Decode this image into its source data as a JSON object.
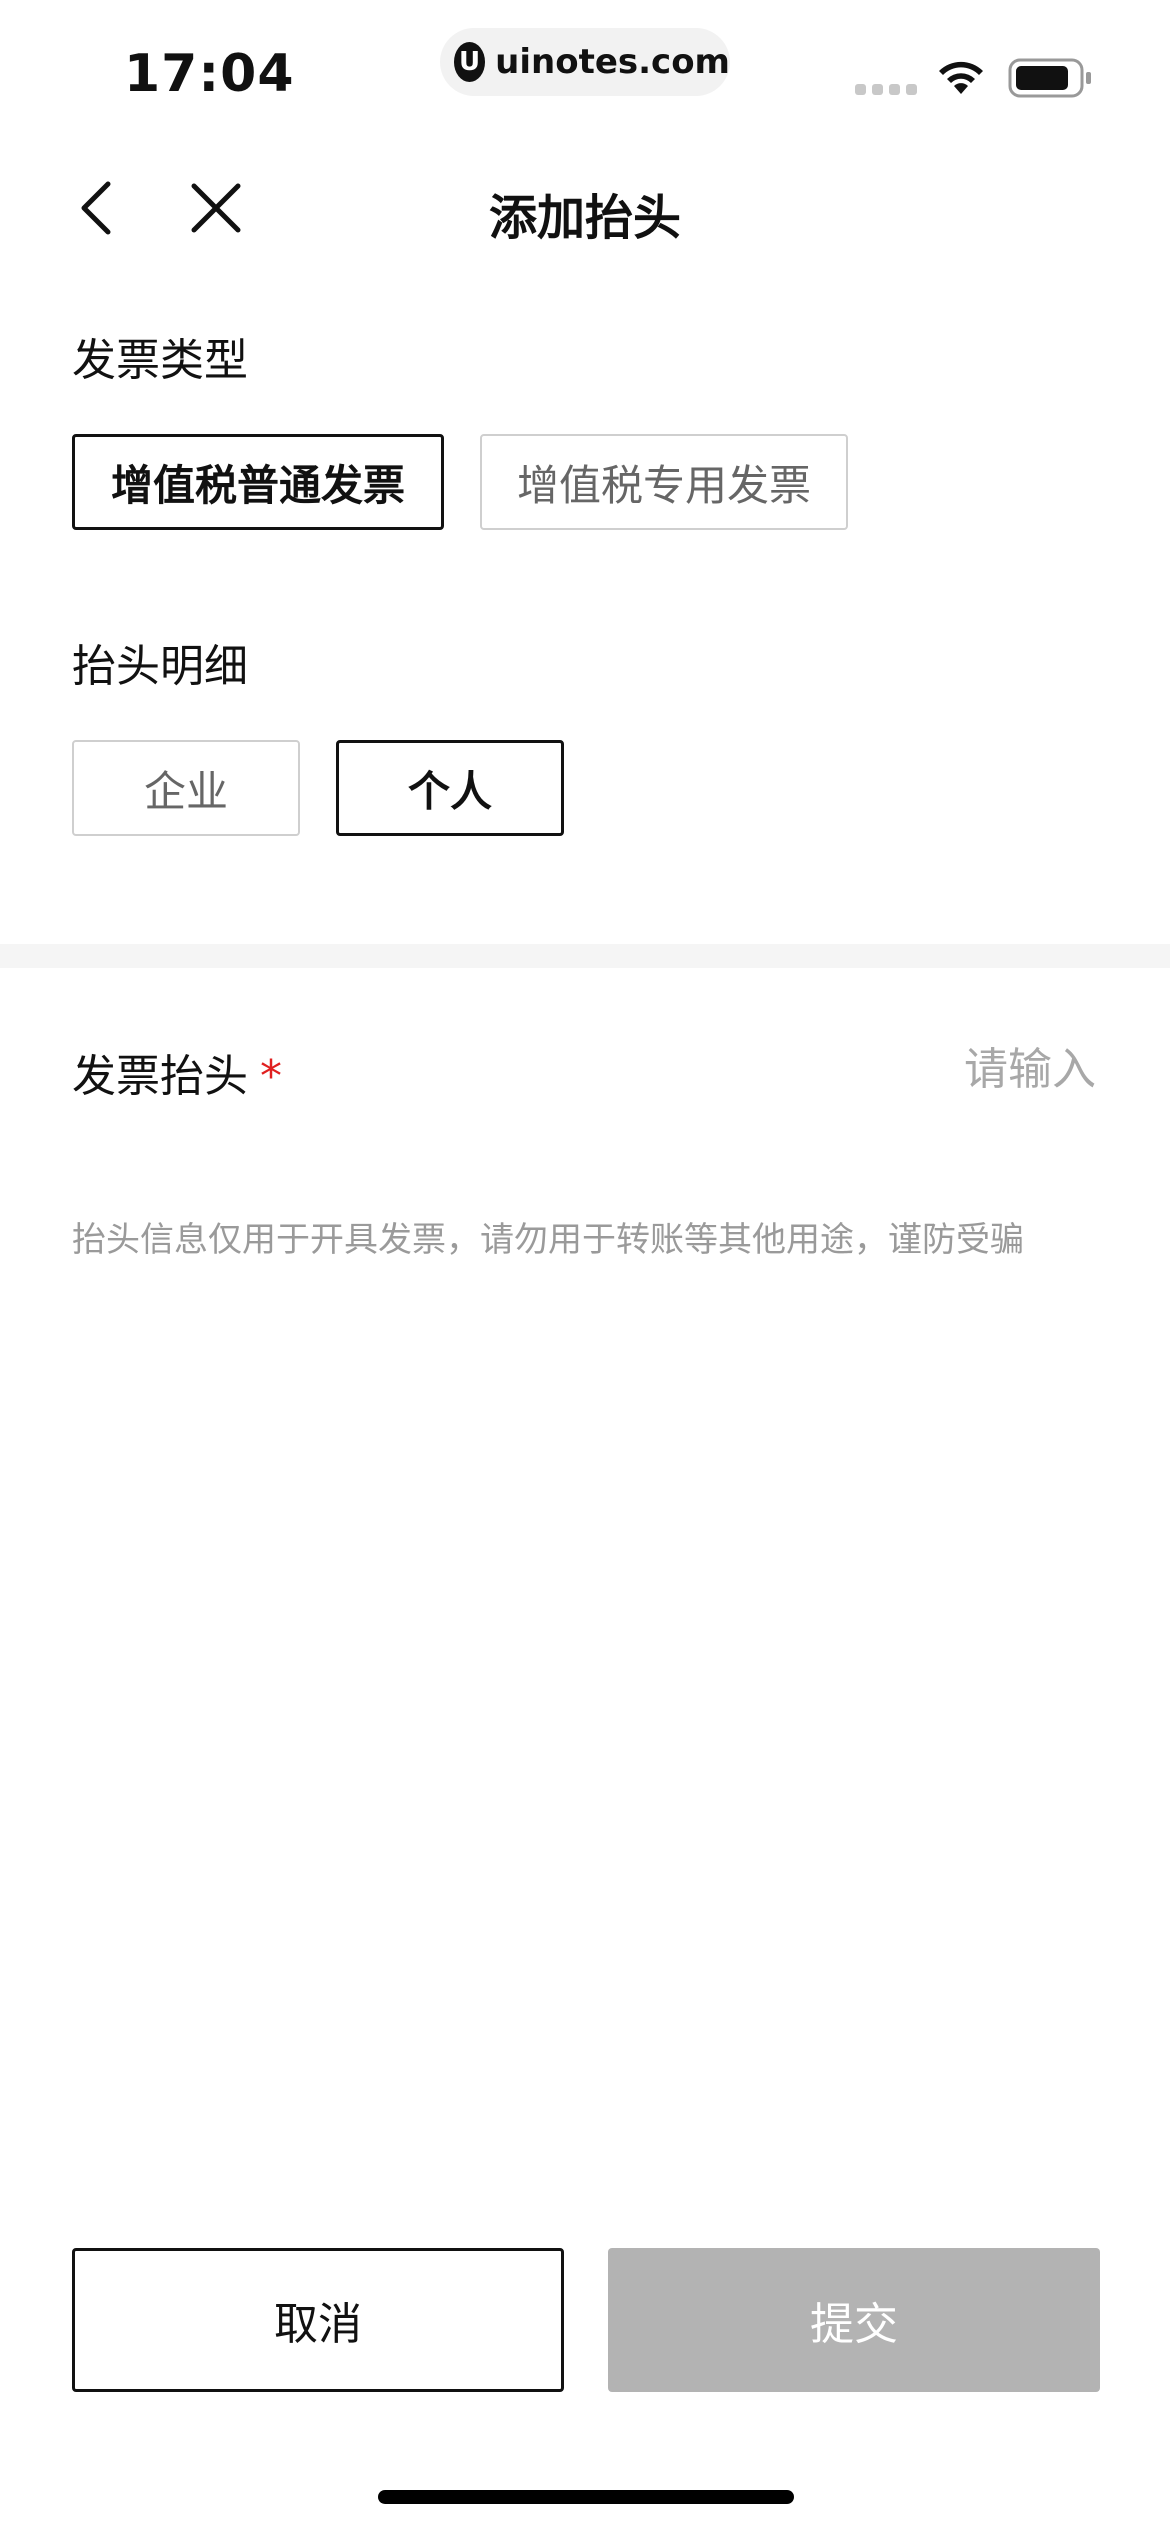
{
  "status_bar": {
    "time": "17:04",
    "url": "uinotes.com",
    "url_logo_letter": "U"
  },
  "nav": {
    "title": "添加抬头",
    "back_icon": "chevron-left-icon",
    "close_icon": "close-icon"
  },
  "invoice_type": {
    "label": "发票类型",
    "options": [
      {
        "label": "增值税普通发票",
        "selected": true
      },
      {
        "label": "增值税专用发票",
        "selected": false
      }
    ]
  },
  "title_detail": {
    "label": "抬头明细",
    "options": [
      {
        "label": "企业",
        "selected": false
      },
      {
        "label": "个人",
        "selected": true
      }
    ]
  },
  "invoice_title_field": {
    "label": "发票抬头",
    "required_mark": "*",
    "value": "",
    "placeholder": "请输入"
  },
  "hint": "抬头信息仅用于开具发票，请勿用于转账等其他用途，谨防受骗",
  "footer": {
    "cancel_label": "取消",
    "submit_label": "提交"
  },
  "colors": {
    "selected_border": "#111111",
    "unselected_border": "#cfcfcf",
    "required": "#e02020",
    "submit_disabled_bg": "#b3b3b3",
    "divider_band": "#f5f5f5"
  }
}
